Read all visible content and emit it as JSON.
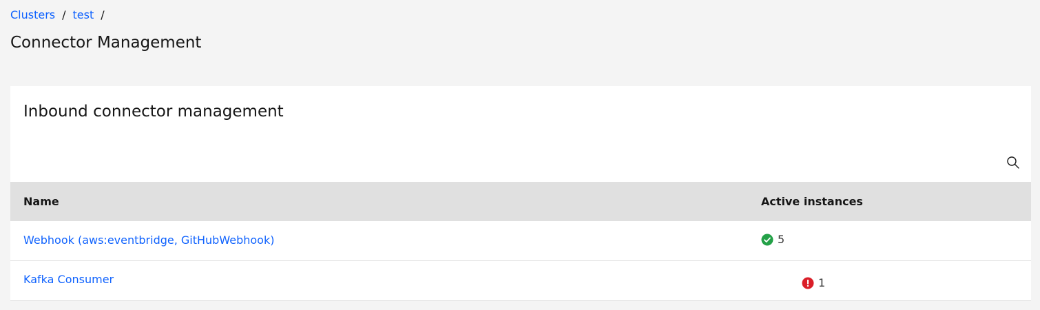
{
  "breadcrumb": {
    "items": [
      {
        "label": "Clusters"
      },
      {
        "label": "test"
      }
    ],
    "separator": "/"
  },
  "page": {
    "title": "Connector Management"
  },
  "card": {
    "title": "Inbound connector management",
    "search_icon": "search-icon"
  },
  "table": {
    "columns": [
      "Name",
      "Active instances"
    ],
    "rows": [
      {
        "name": "Webhook (aws:eventbridge, GitHubWebhook)",
        "status": "success",
        "status_icon": "checkmark-filled-icon",
        "count": "5"
      },
      {
        "name": "Kafka Consumer",
        "status": "error",
        "status_icon": "warning-filled-icon",
        "count": "1"
      }
    ]
  },
  "colors": {
    "link": "#0f62fe",
    "success": "#24a148",
    "error": "#da1e28",
    "header_bg": "#e0e0e0",
    "page_bg": "#f4f4f4"
  }
}
